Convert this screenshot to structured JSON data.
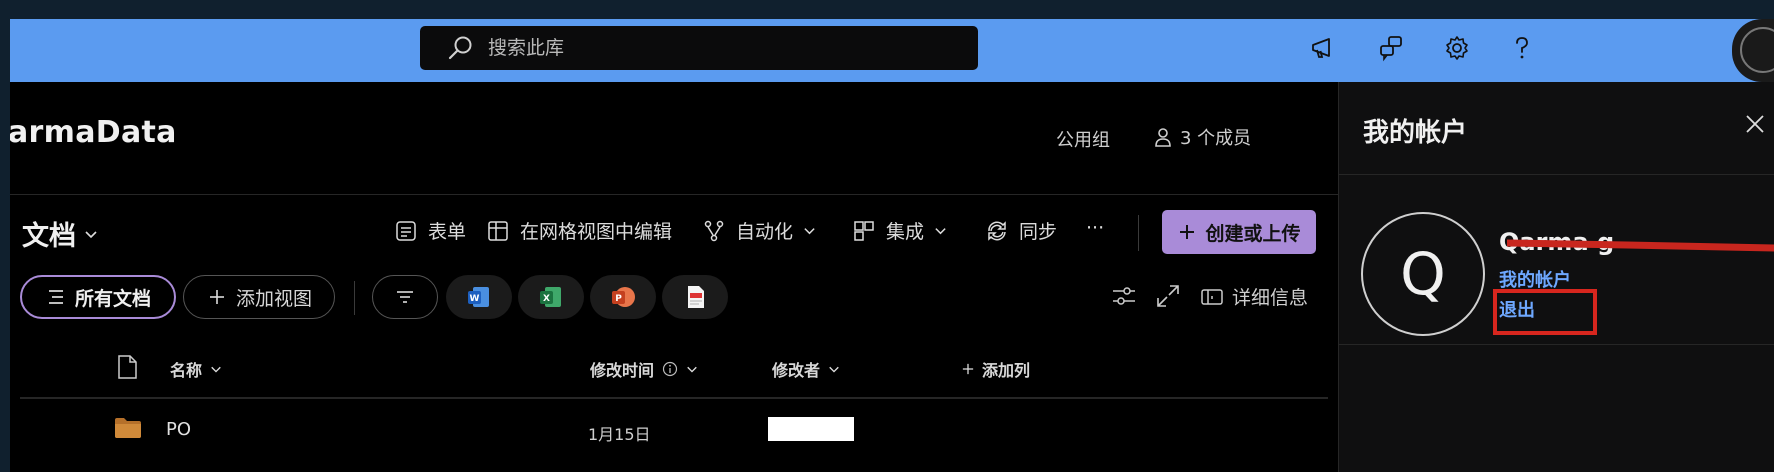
{
  "search": {
    "placeholder": "搜索此库"
  },
  "site": {
    "title": "armaData",
    "group_type": "公用组",
    "members": "3 个成员"
  },
  "library": {
    "title": "文档"
  },
  "commands": {
    "forms": "表单",
    "grid_edit": "在网格视图中编辑",
    "automate": "自动化",
    "integrate": "集成",
    "sync": "同步",
    "more": "···",
    "create_upload": "创建或上传"
  },
  "views": {
    "all_docs": "所有文档",
    "add_view": "添加视图",
    "details": "详细信息"
  },
  "file_filters": [
    "word",
    "excel",
    "powerpoint",
    "pdf"
  ],
  "columns": {
    "name": "名称",
    "modified": "修改时间",
    "modified_by": "修改者",
    "add_column": "添加列"
  },
  "rows": [
    {
      "name": "PO",
      "modified": "1月15日",
      "modified_by": ""
    }
  ],
  "panel": {
    "title": "我的帐户",
    "avatar_initial": "Q",
    "user_name": "Qarma g",
    "my_account": "我的帐户",
    "sign_out": "退出"
  },
  "colors": {
    "topbar": "#5b9bf0",
    "accent": "#a98bd8",
    "link": "#6ea8ff",
    "highlight": "#d7261e"
  }
}
